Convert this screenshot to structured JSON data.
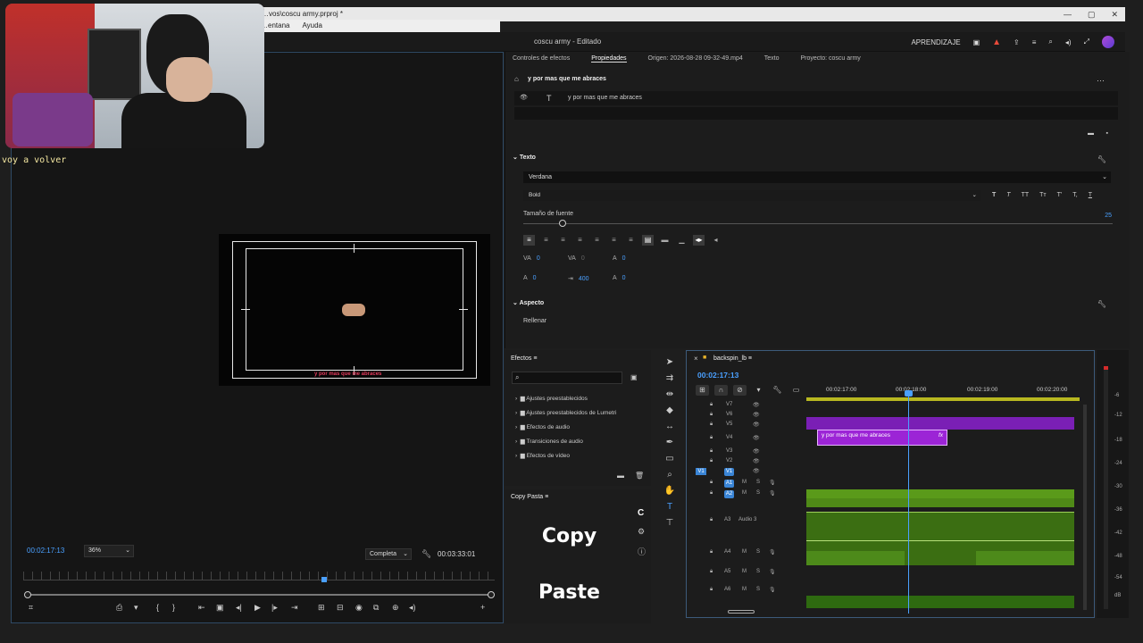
{
  "window": {
    "title": "…vos\\coscu army.prproj *"
  },
  "menu": [
    "…entana",
    "Ayuda"
  ],
  "appbar": {
    "project_title": "coscu army - Editado",
    "learn": "APRENDIZAJE"
  },
  "webcam": {
    "subtitle": "voy a volver"
  },
  "program": {
    "timecode": "00:02:17:13",
    "zoom": "36%",
    "quality": "Completa",
    "duration": "00:03:33:01",
    "title_text": "y por mas que me abraces"
  },
  "properties": {
    "tabs": [
      "Controles de efectos",
      "Propiedades",
      "Origen: 2026-08-28 09-32-49.mp4",
      "Texto",
      "Proyecto: coscu army"
    ],
    "layer_title": "y por mas que me abraces",
    "layer_row": "y por mas que me abraces",
    "text_section": "Texto",
    "font": "Verdana",
    "style": "Bold",
    "font_size_label": "Tamaño de fuente",
    "font_size_value": "25",
    "metrics": {
      "kerning": "0",
      "tracking": "0",
      "leading": "0",
      "baseline": "0",
      "tsume": "400",
      "ruby": "0"
    },
    "appearance_section": "Aspecto",
    "fill": "Rellenar"
  },
  "effects": {
    "title": "Efectos",
    "items": [
      "Ajustes preestablecidos",
      "Ajustes preestablecidos de Lumetri",
      "Efectos de audio",
      "Transiciones de audio",
      "Efectos de vídeo"
    ]
  },
  "copy_panel": {
    "title": "Copy Pasta",
    "copy": "Copy",
    "paste": "Paste"
  },
  "timeline": {
    "sequence": "backspin_lb",
    "timecode": "00:02:17:13",
    "ruler": [
      "00:02:17:00",
      "00:02:18:00",
      "00:02:19:00",
      "00:02:20:00"
    ],
    "tracks": [
      "V7",
      "V6",
      "V5",
      "V4",
      "V3",
      "V2",
      "V1",
      "A1",
      "A2",
      "A3",
      "A4",
      "A5",
      "A6"
    ],
    "a3_name": "Audio 3",
    "title_clip": "y por mas que me abraces"
  },
  "vu": [
    "-6",
    "-12",
    "-18",
    "-24",
    "-30",
    "-36",
    "-42",
    "-48",
    "-54",
    "dB"
  ]
}
